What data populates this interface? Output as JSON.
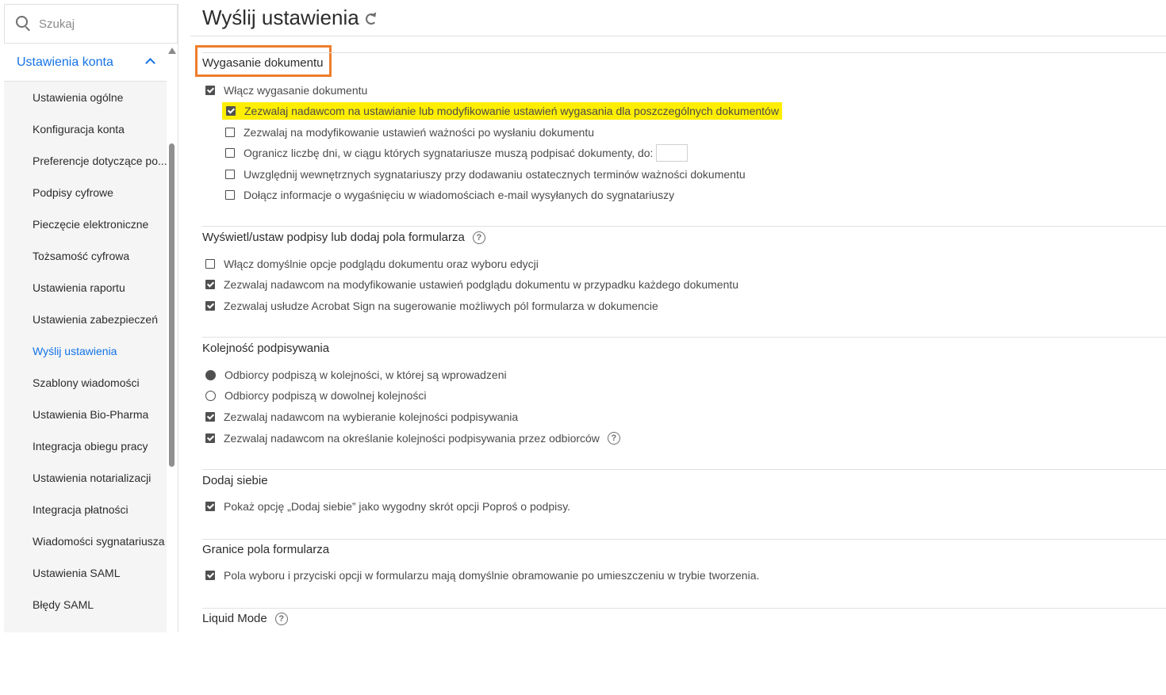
{
  "sidebar": {
    "search_placeholder": "Szukaj",
    "account_section_label": "Ustawienia konta",
    "items": [
      {
        "label": "Ustawienia ogólne"
      },
      {
        "label": "Konfiguracja konta"
      },
      {
        "label": "Preferencje dotyczące po..."
      },
      {
        "label": "Podpisy cyfrowe"
      },
      {
        "label": "Pieczęcie elektroniczne"
      },
      {
        "label": "Tożsamość cyfrowa"
      },
      {
        "label": "Ustawienia raportu"
      },
      {
        "label": "Ustawienia zabezpieczeń"
      },
      {
        "label": "Wyślij ustawienia",
        "active": true
      },
      {
        "label": "Szablony wiadomości"
      },
      {
        "label": "Ustawienia Bio-Pharma"
      },
      {
        "label": "Integracja obiegu pracy"
      },
      {
        "label": "Ustawienia notarializacji"
      },
      {
        "label": "Integracja płatności"
      },
      {
        "label": "Wiadomości sygnatariusza"
      },
      {
        "label": "Ustawienia SAML"
      },
      {
        "label": "Błędy SAML"
      }
    ]
  },
  "main": {
    "title": "Wyślij ustawienia",
    "expiration": {
      "heading": "Wygasanie dokumentu",
      "enable": {
        "label": "Włącz wygasanie dokumentu",
        "checked": true
      },
      "allow_senders": {
        "label": "Zezwalaj nadawcom na ustawianie lub modyfikowanie ustawień wygasania dla poszczególnych dokumentów",
        "checked": true
      },
      "allow_modify_after_send": {
        "label": "Zezwalaj na modyfikowanie ustawień ważności po wysłaniu dokumentu",
        "checked": false
      },
      "limit_days": {
        "label": "Ogranicz liczbę dni, w ciągu których sygnatariusze muszą podpisać dokumenty, do:",
        "checked": false,
        "value": ""
      },
      "include_internal": {
        "label": "Uwzględnij wewnętrznych sygnatariuszy przy dodawaniu ostatecznych terminów ważności dokumentu",
        "checked": false
      },
      "include_info_email": {
        "label": "Dołącz informacje o wygaśnięciu w wiadomościach e-mail wysyłanych do sygnatariuszy",
        "checked": false
      }
    },
    "preview": {
      "heading": "Wyświetl/ustaw podpisy lub dodaj pola formularza",
      "default_preview": {
        "label": "Włącz domyślnie opcje podglądu dokumentu oraz wyboru edycji",
        "checked": false
      },
      "allow_modify_preview": {
        "label": "Zezwalaj nadawcom na modyfikowanie ustawień podglądu dokumentu w przypadku każdego dokumentu",
        "checked": true
      },
      "suggest_fields": {
        "label": "Zezwalaj usłudze Acrobat Sign na sugerowanie możliwych pól formularza w dokumencie",
        "checked": true
      }
    },
    "order": {
      "heading": "Kolejność podpisywania",
      "in_order": {
        "label": "Odbiorcy podpiszą w kolejności, w której są wprowadzeni",
        "selected": true
      },
      "any_order": {
        "label": "Odbiorcy podpiszą w dowolnej kolejności",
        "selected": false
      },
      "allow_choose": {
        "label": "Zezwalaj nadawcom na wybieranie kolejności podpisywania",
        "checked": true
      },
      "allow_define": {
        "label": "Zezwalaj nadawcom na określanie kolejności podpisywania przez odbiorców",
        "checked": true
      }
    },
    "add_self": {
      "heading": "Dodaj siebie",
      "show_option": {
        "label": "Pokaż opcję „Dodaj siebie” jako wygodny skrót opcji Poproś o podpisy.",
        "checked": true
      }
    },
    "borders": {
      "heading": "Granice pola formularza",
      "default_border": {
        "label": "Pola wyboru i przyciski opcji w formularzu mają domyślnie obramowanie po umieszczeniu w trybie tworzenia.",
        "checked": true
      }
    },
    "liquid": {
      "heading": "Liquid Mode"
    },
    "colors": {
      "accent": "#1473e6",
      "highlight": "#ffee00",
      "callout": "#ee7d2b"
    }
  }
}
